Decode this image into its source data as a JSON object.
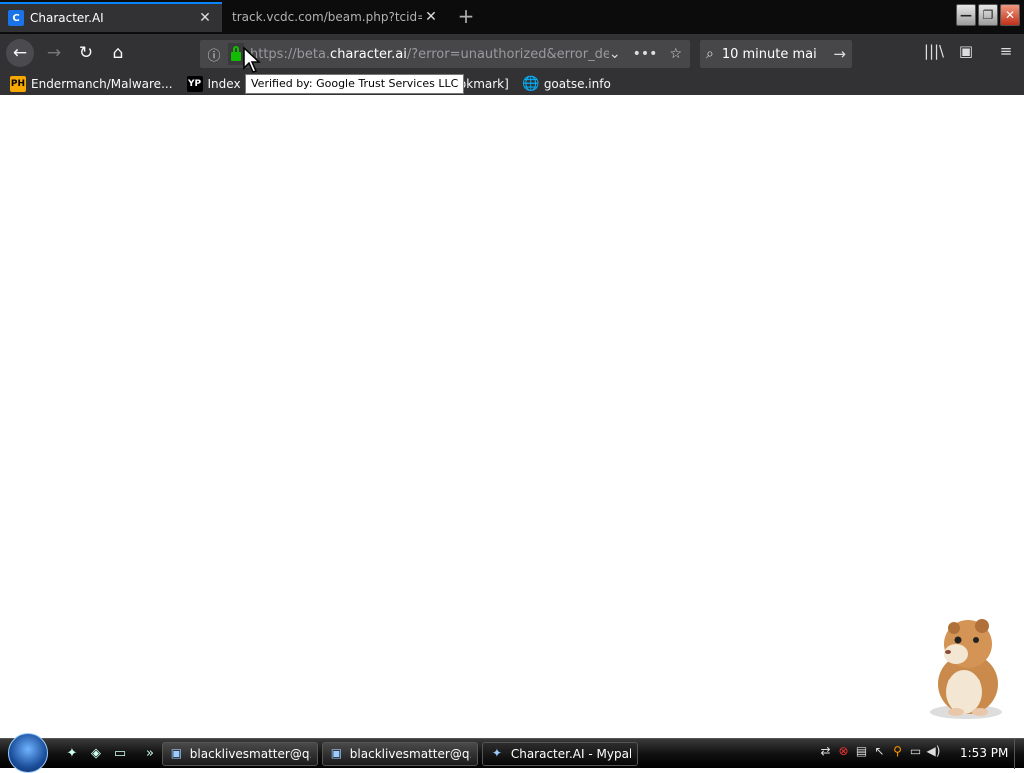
{
  "browser": {
    "tabs": [
      {
        "title": "Character.AI",
        "favicon": "character-ai-icon",
        "active": true
      },
      {
        "title": "track.vcdc.com/beam.php?tcid=&",
        "active": false
      }
    ],
    "newtab_label": "+",
    "window_controls": {
      "minimize": "—",
      "maximize": "❐",
      "close": "✕"
    },
    "nav": {
      "back": "←",
      "forward": "→",
      "reload": "↻",
      "home": "⌂"
    },
    "url": {
      "prefix": "https://beta.",
      "host": "character.ai",
      "suffix": "/?error=unauthorized&error_desc"
    },
    "url_actions": {
      "dropdown": "⌄",
      "more": "•••",
      "bookmark_star": "☆"
    },
    "search": {
      "value": "10 minute mai",
      "icon": "search-icon",
      "go": "→"
    },
    "toolbar_right": {
      "library": "|||\\",
      "sidebar": "▣",
      "menu": "≡"
    },
    "bookmarks": [
      {
        "label": "Endermanch/Malware...",
        "icon_text": "PH"
      },
      {
        "label": "Index of \"",
        "icon_text": "YP"
      },
      {
        "label": "[bookmark]",
        "icon_text": ""
      },
      {
        "label": "goatse.info",
        "icon_text": "🌐"
      }
    ],
    "tooltip": "Verified by: Google Trust Services LLC"
  },
  "taskbar": {
    "tasks": [
      {
        "label": "blacklivesmatter@q...",
        "active": false
      },
      {
        "label": "blacklivesmatter@q...",
        "active": false
      },
      {
        "label": "Character.AI - Mypal",
        "active": true
      }
    ],
    "overflow": "»",
    "clock": "1:53 PM"
  }
}
